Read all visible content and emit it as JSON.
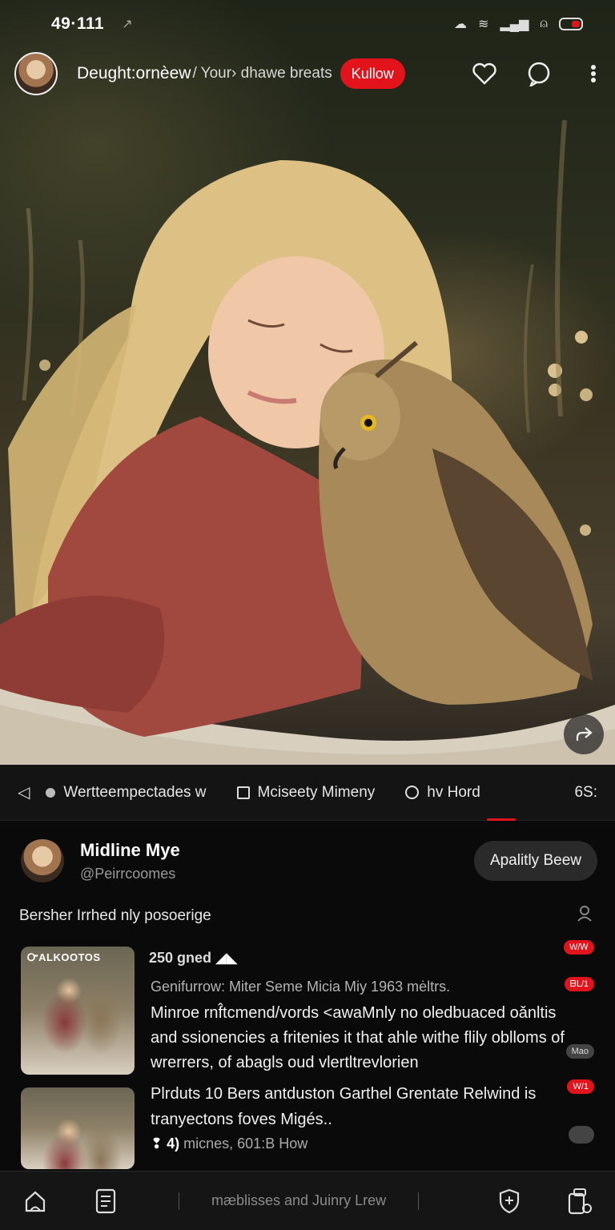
{
  "status": {
    "time": "49·111"
  },
  "topbar": {
    "title": "Deught:ornèew",
    "subtitle": "/ Your› dhawe breats",
    "follow_label": "Kullow"
  },
  "tabs": [
    {
      "label": "Wertteempectades w",
      "icon": "dot-icon"
    },
    {
      "label": "Mciseety Mimeny",
      "icon": "square-icon"
    },
    {
      "label": "hv Hord",
      "icon": "circle-icon"
    }
  ],
  "tab_count": "6S:",
  "channel": {
    "name": "Midline Mye",
    "handle": "@Peirrcoomes",
    "subscribe_label": "Apalitly Beew"
  },
  "description": "Bersher Irrhed nly posoerige",
  "items": [
    {
      "thumb_label": "ᏅALKOOTOS",
      "meta": "250 gned",
      "subline": "Genifurrow: Miter Seme Micia Miy 1963 mėltrs.",
      "body": "Minroe rnf̂tcmend/vords <awaMnly no oledbuaced oǎnltis and ssionencies a fritenies it that ahle withe flily oblloms of wrerrers, of abagls oud vlertltrevlorien",
      "badges": [
        "W/Ꮃ",
        "ᗷᒪ/1",
        "Mao"
      ]
    },
    {
      "title": "Plrduts 10 Bers antduston Garthel Grentate Relwind is tranyectons foves Migés..",
      "stats_prefix": "4)",
      "stats": "micnes, 601:B How",
      "badges": [
        "W/1"
      ]
    }
  ],
  "bottomnav": {
    "label": "mæblisses and Juinry Lrew"
  },
  "colors": {
    "accent": "#e3131c",
    "background": "#0a0a0a",
    "surface": "#141414"
  }
}
